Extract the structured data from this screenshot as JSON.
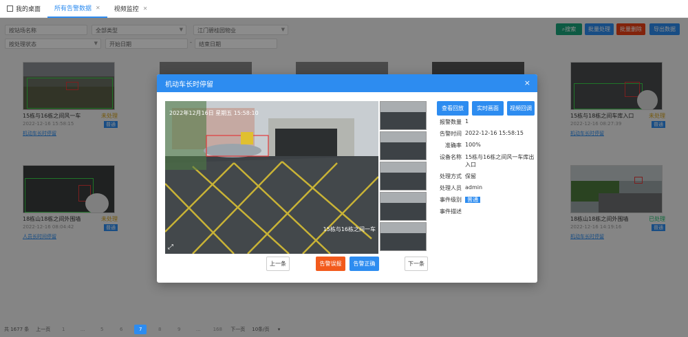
{
  "tabs": [
    {
      "label": "我的桌面"
    },
    {
      "label": "所有告警数据"
    },
    {
      "label": "视频监控"
    }
  ],
  "filters": {
    "site": "按站场名称",
    "type": "全部类型",
    "company": "江门碧桂园物业",
    "status": "按处理状态",
    "start": "开始日期",
    "end": "结束日期"
  },
  "toolbar": {
    "search": "搜索",
    "batch_handle": "批量处理",
    "batch_delete": "批量删除",
    "export": "导出数据"
  },
  "cards": [
    {
      "title": "15栋与16栋之间风一车",
      "status": "未处理",
      "time": "2022-12-16 15:58:15",
      "level": "普通",
      "tag": "机动车长时停留"
    },
    {
      "title": "15栋与18栋之间车库入口",
      "status": "未处理",
      "time": "2022-12-16 08:27:39",
      "level": "普通",
      "tag": "机动车长时停留"
    },
    {
      "title": "18栋山18栋之间外围墙",
      "status": "未处理",
      "time": "2022-12-16 08:04:42",
      "level": "普通",
      "tag": "人员长时间停留"
    },
    {
      "title": "18栋山18栋之间外围墙",
      "status": "已处理",
      "time": "2022-12-16 14:19:16",
      "level": "普通",
      "tag": "机动车长时停留"
    }
  ],
  "pager": {
    "total": "共 1677 条",
    "prev": "上一页",
    "pages": [
      "1",
      "...",
      "5",
      "6",
      "7",
      "8",
      "9",
      "...",
      "168"
    ],
    "next": "下一页",
    "size": "10条/页"
  },
  "modal": {
    "title": "机动车长时停留",
    "close": "×",
    "overlay_time": "2022年12月16日 星期五 15:58:10",
    "overlay_cam": "15栋与16栋之间一车",
    "view_video": "查看回放",
    "compare": "实时画面",
    "record": "视频回调",
    "info": {
      "k_count": "报警数量",
      "v_count": "1",
      "k_time": "告警时间",
      "v_time": "2022-12-16 15:58:15",
      "k_conf": "准确率",
      "v_conf": "100%",
      "k_dev": "设备名称",
      "v_dev": "15栋与16栋之间风一车库出入口",
      "k_method": "处理方式",
      "v_method": "保留",
      "k_person": "处理人员",
      "v_person": "admin",
      "k_level": "事件级别",
      "v_level": "普通",
      "k_desc": "事件描述",
      "v_desc": ""
    },
    "prev": "上一条",
    "false_alarm": "告警误报",
    "confirm": "告警正确",
    "next": "下一条"
  }
}
